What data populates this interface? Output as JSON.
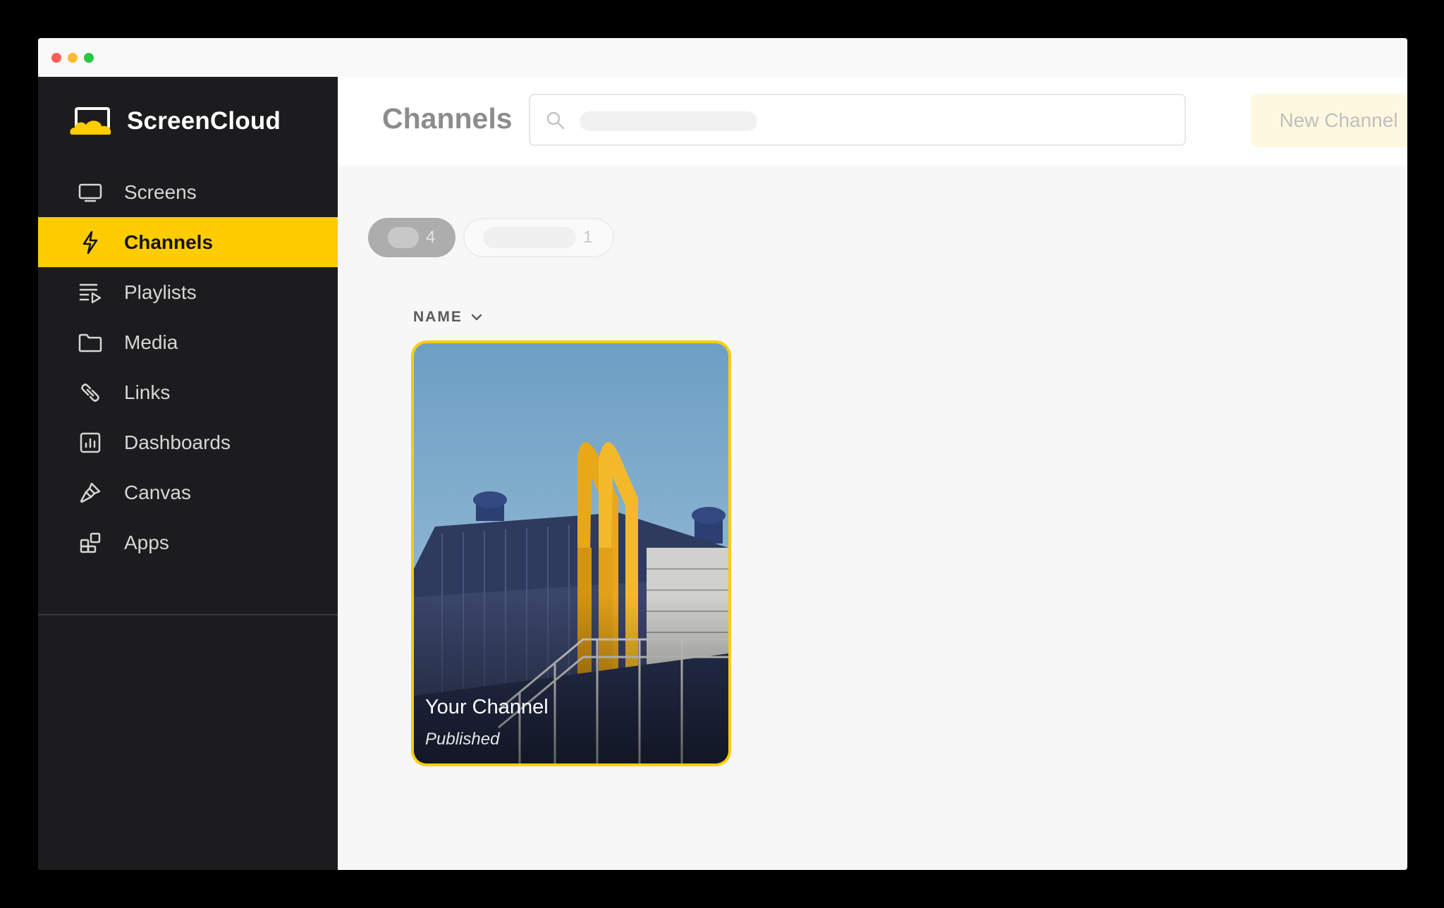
{
  "app": {
    "name": "ScreenCloud"
  },
  "window": {
    "controls": [
      "close",
      "minimize",
      "zoom"
    ]
  },
  "sidebar": {
    "items": [
      {
        "label": "Screens",
        "icon": "monitor-icon",
        "active": false
      },
      {
        "label": "Channels",
        "icon": "lightning-icon",
        "active": true
      },
      {
        "label": "Playlists",
        "icon": "playlist-icon",
        "active": false
      },
      {
        "label": "Media",
        "icon": "folder-icon",
        "active": false
      },
      {
        "label": "Links",
        "icon": "link-icon",
        "active": false
      },
      {
        "label": "Dashboards",
        "icon": "dashboard-icon",
        "active": false
      },
      {
        "label": "Canvas",
        "icon": "brush-icon",
        "active": false
      },
      {
        "label": "Apps",
        "icon": "apps-icon",
        "active": false
      }
    ]
  },
  "header": {
    "title": "Channels",
    "search": {
      "placeholder": ""
    },
    "new_button_label": "New Channel"
  },
  "filters": [
    {
      "count": "4",
      "selected": true
    },
    {
      "count": "1",
      "selected": false
    }
  ],
  "sort": {
    "label": "NAME",
    "icon": "chevron-down-icon"
  },
  "channels": [
    {
      "name": "Your Channel",
      "status": "Published"
    }
  ],
  "colors": {
    "accent": "#ffcc00",
    "sidebar_bg": "#1c1c1e",
    "content_bg": "#f7f7f7"
  }
}
